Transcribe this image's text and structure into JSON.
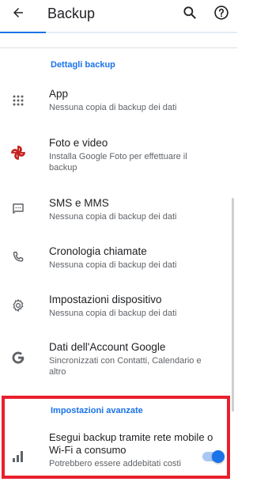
{
  "appbar": {
    "title": "Backup",
    "back_icon": "arrow-back-icon",
    "search_icon": "search-icon",
    "help_icon": "help-icon"
  },
  "sections": {
    "backup_details_header": "Dettagli backup",
    "advanced_header": "Impostazioni avanzate"
  },
  "items": [
    {
      "icon": "apps-grid-icon",
      "title": "App",
      "subtitle": "Nessuna copia di backup dei dati"
    },
    {
      "icon": "pinwheel-icon",
      "title": "Foto e video",
      "subtitle": "Installa Google Foto per effettuare il backup"
    },
    {
      "icon": "message-icon",
      "title": "SMS e MMS",
      "subtitle": "Nessuna copia di backup dei dati"
    },
    {
      "icon": "phone-icon",
      "title": "Cronologia chiamate",
      "subtitle": "Nessuna copia di backup dei dati"
    },
    {
      "icon": "settings-gear-icon",
      "title": "Impostazioni dispositivo",
      "subtitle": "Nessuna copia di backup dei dati"
    },
    {
      "icon": "google-g-icon",
      "title": "Dati dell'Account Google",
      "subtitle": "Sincronizzati con Contatti, Calendario e altro"
    }
  ],
  "advanced": {
    "icon": "signal-bars-icon",
    "title": "Esegui backup tramite rete mobile o Wi-Fi a consumo",
    "subtitle": "Potrebbero essere addebitati costi",
    "toggle_on": true
  },
  "colors": {
    "accent": "#1a73e8",
    "highlight": "#e8202d",
    "pinwheel": "#c5221f"
  }
}
